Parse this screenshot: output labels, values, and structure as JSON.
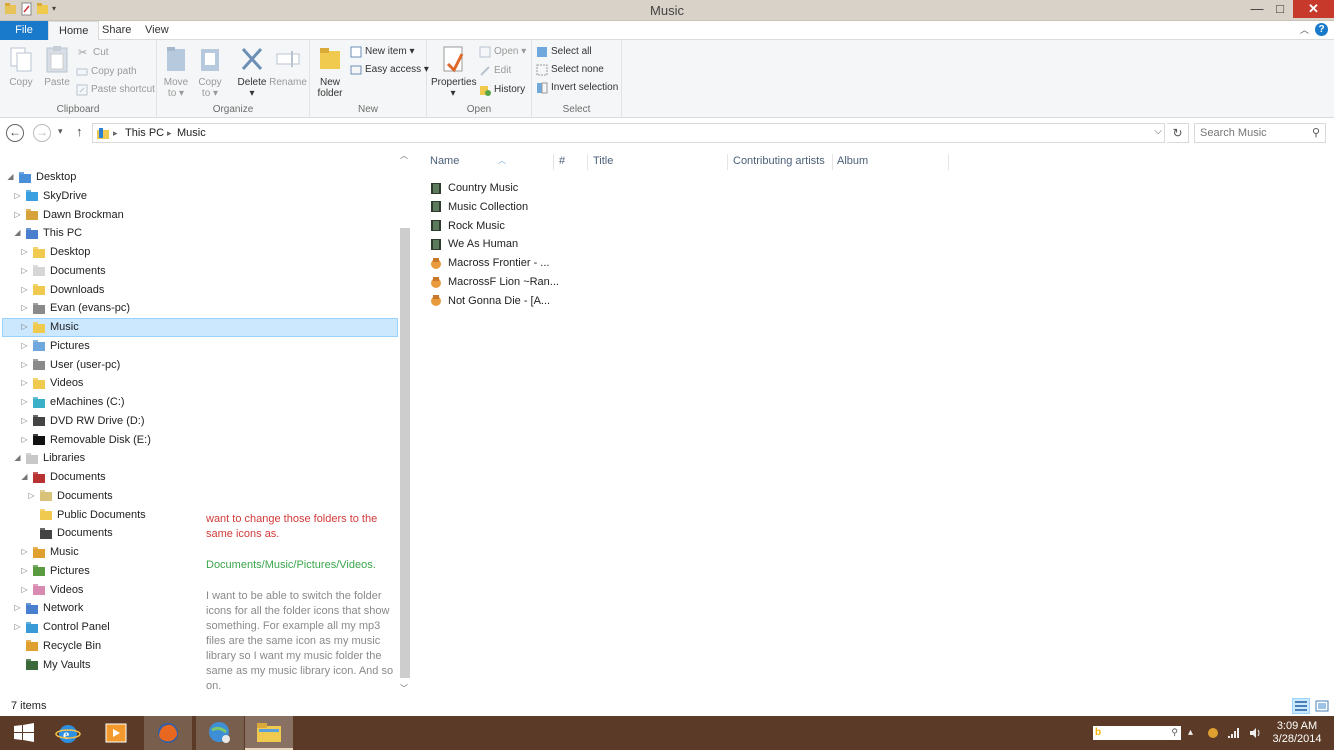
{
  "window": {
    "title": "Music"
  },
  "titlebar": {
    "minimize": "—",
    "maximize": "□",
    "close": "✕"
  },
  "tabs": {
    "file": "File",
    "home": "Home",
    "share": "Share",
    "view": "View",
    "help": "?"
  },
  "ribbon": {
    "clipboard": {
      "label": "Clipboard",
      "copy": "Copy",
      "paste": "Paste",
      "cut": "Cut",
      "copy_path": "Copy path",
      "paste_shortcut": "Paste shortcut"
    },
    "organize": {
      "label": "Organize",
      "move_to": "Move",
      "move_to_2": "to ▾",
      "copy_to": "Copy",
      "copy_to_2": "to ▾",
      "delete": "Delete",
      "delete_2": "▾",
      "rename": "Rename"
    },
    "new": {
      "label": "New",
      "new_folder": "New",
      "new_folder_2": "folder",
      "new_item": "New item ▾",
      "easy_access": "Easy access ▾"
    },
    "open": {
      "label": "Open",
      "properties": "Properties",
      "properties_2": "▾",
      "open": "Open ▾",
      "edit": "Edit",
      "history": "History"
    },
    "select": {
      "label": "Select",
      "select_all": "Select all",
      "select_none": "Select none",
      "invert_selection": "Invert selection"
    }
  },
  "address": {
    "crumbs": [
      "This PC",
      "Music"
    ],
    "sep": "▸",
    "search_placeholder": "Search Music"
  },
  "tree": [
    {
      "label": "Desktop",
      "arrow": "◢",
      "indent": 0
    },
    {
      "label": "SkyDrive",
      "arrow": "▷",
      "indent": 1
    },
    {
      "label": "Dawn Brockman",
      "arrow": "▷",
      "indent": 1
    },
    {
      "label": "This PC",
      "arrow": "◢",
      "indent": 1
    },
    {
      "label": "Desktop",
      "arrow": "▷",
      "indent": 2
    },
    {
      "label": "Documents",
      "arrow": "▷",
      "indent": 2
    },
    {
      "label": "Downloads",
      "arrow": "▷",
      "indent": 2
    },
    {
      "label": "Evan (evans-pc)",
      "arrow": "▷",
      "indent": 2
    },
    {
      "label": "Music",
      "arrow": "▷",
      "indent": 2
    },
    {
      "label": "Pictures",
      "arrow": "▷",
      "indent": 2
    },
    {
      "label": "User (user-pc)",
      "arrow": "▷",
      "indent": 2
    },
    {
      "label": "Videos",
      "arrow": "▷",
      "indent": 2
    },
    {
      "label": "eMachines (C:)",
      "arrow": "▷",
      "indent": 2
    },
    {
      "label": "DVD RW Drive (D:)",
      "arrow": "▷",
      "indent": 2
    },
    {
      "label": "Removable Disk (E:)",
      "arrow": "▷",
      "indent": 2
    },
    {
      "label": "Libraries",
      "arrow": "◢",
      "indent": 1
    },
    {
      "label": "Documents",
      "arrow": "◢",
      "indent": 2
    },
    {
      "label": "Documents",
      "arrow": "▷",
      "indent": 3
    },
    {
      "label": "Public Documents",
      "arrow": "",
      "indent": 3
    },
    {
      "label": "Documents",
      "arrow": "",
      "indent": 3
    },
    {
      "label": "Music",
      "arrow": "▷",
      "indent": 2
    },
    {
      "label": "Pictures",
      "arrow": "▷",
      "indent": 2
    },
    {
      "label": "Videos",
      "arrow": "▷",
      "indent": 2
    },
    {
      "label": "Network",
      "arrow": "▷",
      "indent": 1
    },
    {
      "label": "Control Panel",
      "arrow": "▷",
      "indent": 1
    },
    {
      "label": "Recycle Bin",
      "arrow": "",
      "indent": 1
    },
    {
      "label": "My Vaults",
      "arrow": "",
      "indent": 1
    }
  ],
  "notes": {
    "red": "want to change those folders to the same icons as.",
    "green": "Documents/Music/Pictures/Videos.",
    "gray": "I want to be able to switch the folder icons for all the folder icons that show something. For example all my mp3 files are the same icon as my music library so I want my music folder the same as my music library icon. And so on."
  },
  "columns": [
    "Name",
    "#",
    "Title",
    "Contributing artists",
    "Album"
  ],
  "files": [
    {
      "name": "Country Music",
      "kind": "folder"
    },
    {
      "name": "Music Collection",
      "kind": "folder"
    },
    {
      "name": "Rock Music",
      "kind": "folder"
    },
    {
      "name": "We As Human",
      "kind": "folder"
    },
    {
      "name": "Macross Frontier - ...",
      "kind": "music"
    },
    {
      "name": "MacrossF Lion ~Ran...",
      "kind": "music"
    },
    {
      "name": "Not Gonna Die - [A...",
      "kind": "music"
    }
  ],
  "status": {
    "count": "7 items"
  },
  "clock": {
    "time": "3:09 AM",
    "date": "3/28/2014"
  },
  "colors": {
    "accent": "#1979ca",
    "selection": "#cce8ff",
    "taskbar": "#5b3b27",
    "note_red": "#d33a3a",
    "note_green": "#3aa64b"
  }
}
